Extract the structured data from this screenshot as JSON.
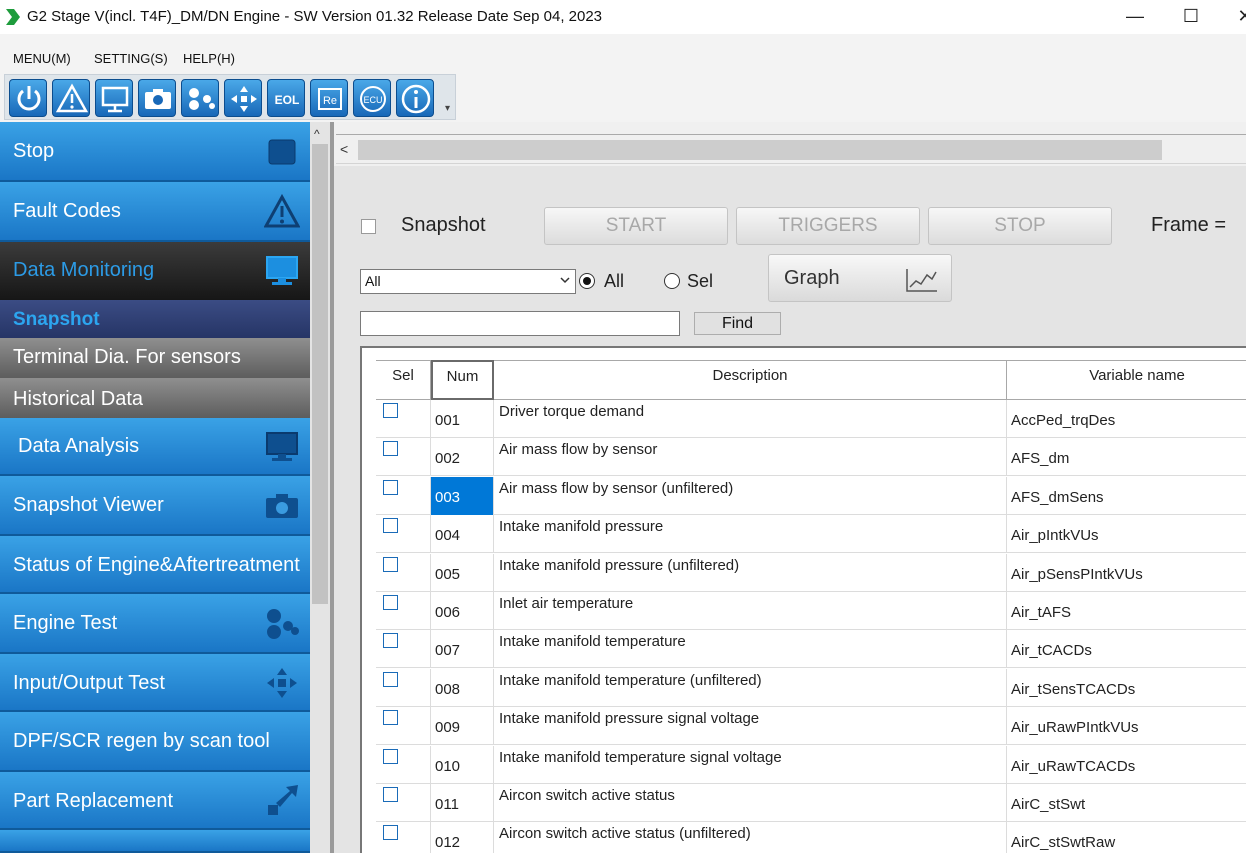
{
  "window": {
    "title": "G2 Stage V(incl. T4F)_DM/DN Engine - SW Version 01.32 Release Date Sep 04, 2023",
    "minimize": "—",
    "maximize": "☐",
    "close": "✕"
  },
  "menu": {
    "menu_label": "MENU(M)",
    "setting_label": "SETTING(S)",
    "help_label": "HELP(H)"
  },
  "toolbar": {
    "buttons": [
      "power-icon",
      "warning-icon",
      "monitor-icon",
      "camera-icon",
      "engine-test-icon",
      "io-test-icon",
      "eol-icon",
      "re-icon",
      "ecu-icon",
      "info-icon"
    ],
    "eol_text": "EOL",
    "re_text": "Re",
    "ecu_text": "ECU"
  },
  "sidebar": {
    "items": [
      {
        "label": "Stop",
        "icon": "stop-icon"
      },
      {
        "label": "Fault Codes",
        "icon": "warning-icon"
      },
      {
        "label": "Data Monitoring",
        "icon": "monitor-icon"
      },
      {
        "label": "Snapshot"
      },
      {
        "label": "Terminal Dia. For sensors"
      },
      {
        "label": "Historical Data"
      },
      {
        "label": "Data Analysis",
        "icon": "monitor-icon"
      },
      {
        "label": "Snapshot Viewer",
        "icon": "camera-icon"
      },
      {
        "label": "Status of Engine&Aftertreatment"
      },
      {
        "label": "Engine Test",
        "icon": "engine-test-icon"
      },
      {
        "label": "Input/Output Test",
        "icon": "io-test-icon"
      },
      {
        "label": "DPF/SCR regen by scan tool"
      },
      {
        "label": "Part Replacement",
        "icon": "replace-icon"
      }
    ],
    "scroll_up": "^"
  },
  "main": {
    "scroll_left": "<",
    "snapshot_label": "Snapshot",
    "start_label": "START",
    "triggers_label": "TRIGGERS",
    "stop_label": "STOP",
    "frame_label": "Frame =",
    "filter_value": "All",
    "radio_all": "All",
    "radio_sel": "Sel",
    "graph_label": "Graph",
    "find_label": "Find",
    "find_value": ""
  },
  "table": {
    "columns": [
      "Sel",
      "Num",
      "Description",
      "Variable name"
    ],
    "selected_row": 2,
    "rows": [
      {
        "num": "001",
        "description": "Driver torque demand",
        "variable": "AccPed_trqDes"
      },
      {
        "num": "002",
        "description": "Air mass flow by sensor",
        "variable": "AFS_dm"
      },
      {
        "num": "003",
        "description": "Air mass flow by sensor (unfiltered)",
        "variable": "AFS_dmSens"
      },
      {
        "num": "004",
        "description": "Intake manifold pressure",
        "variable": "Air_pIntkVUs"
      },
      {
        "num": "005",
        "description": "Intake manifold pressure (unfiltered)",
        "variable": "Air_pSensPIntkVUs"
      },
      {
        "num": "006",
        "description": "Inlet air temperature",
        "variable": "Air_tAFS"
      },
      {
        "num": "007",
        "description": "Intake manifold temperature",
        "variable": "Air_tCACDs"
      },
      {
        "num": "008",
        "description": "Intake manifold temperature (unfiltered)",
        "variable": "Air_tSensTCACDs"
      },
      {
        "num": "009",
        "description": "Intake manifold pressure signal voltage",
        "variable": "Air_uRawPIntkVUs"
      },
      {
        "num": "010",
        "description": "Intake manifold temperature signal voltage",
        "variable": "Air_uRawTCACDs"
      },
      {
        "num": "011",
        "description": "Aircon switch active status",
        "variable": "AirC_stSwt"
      },
      {
        "num": "012",
        "description": "Aircon switch active status (unfiltered)",
        "variable": "AirC_stSwtRaw"
      }
    ]
  },
  "colors": {
    "nav_blue": "#1a76c6",
    "selection": "#0078d7",
    "submenu_highlight": "#2ca6f0"
  }
}
